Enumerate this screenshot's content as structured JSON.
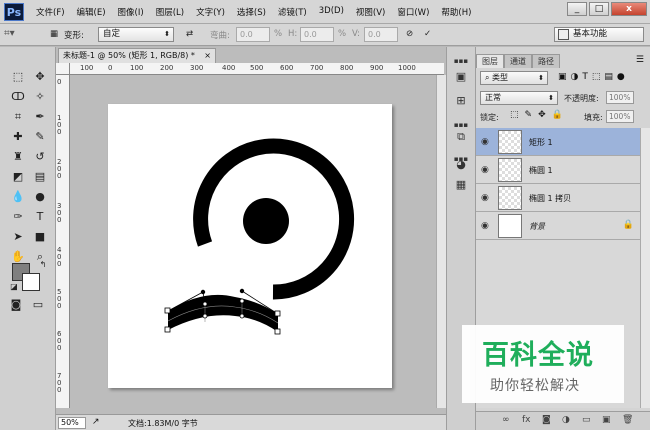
{
  "app": {
    "logo": "Ps"
  },
  "menu": [
    "文件(F)",
    "编辑(E)",
    "图像(I)",
    "图层(L)",
    "文字(Y)",
    "选择(S)",
    "滤镜(T)",
    "3D(D)",
    "视图(V)",
    "窗口(W)",
    "帮助(H)"
  ],
  "window_buttons": {
    "minimize": "_",
    "maximize": "□",
    "close": "x"
  },
  "options": {
    "transform_label": "变形:",
    "transform_value": "自定",
    "bend_label": "弯曲:",
    "bend_value": "0.0",
    "h_label": "H:",
    "h_value": "0.0",
    "percent1": "%",
    "v_label": "V:",
    "v_value": "0.0",
    "percent2": "%",
    "workspace": "基本功能"
  },
  "document": {
    "tab_title": "未标题-1 @ 50% (矩形 1, RGB/8) *",
    "close": "×",
    "ruler_h": [
      "100",
      "0",
      "100",
      "200",
      "300",
      "400",
      "500",
      "600",
      "700",
      "800",
      "900",
      "1000"
    ],
    "ruler_v": [
      "0",
      "1\n0\n0",
      "2\n0\n0",
      "3\n0\n0",
      "4\n0\n0",
      "5\n0\n0",
      "6\n0\n0",
      "7\n0\n0"
    ],
    "zoom": "50%",
    "doc_info": "文档:1.83M/0 字节"
  },
  "layers_panel": {
    "tabs": [
      "图层",
      "通道",
      "路径"
    ],
    "filter_type": "类型",
    "blend_mode": "正常",
    "opacity_label": "不透明度:",
    "opacity_value": "100%",
    "lock_label": "锁定:",
    "fill_label": "填充:",
    "fill_value": "100%",
    "layers": [
      {
        "name": "矩形 1",
        "selected": true
      },
      {
        "name": "椭圆 1",
        "selected": false
      },
      {
        "name": "椭圆 1 拷贝",
        "selected": false
      },
      {
        "name": "背景",
        "selected": false,
        "locked": true
      }
    ],
    "bottom_icons": [
      "link-icon",
      "fx-icon",
      "mask-icon",
      "adjustment-icon",
      "group-icon",
      "new-layer-icon",
      "trash-icon"
    ]
  },
  "watermark": {
    "title": "百科全说",
    "subtitle": "助你轻松解决"
  },
  "colors": {
    "accent_selected": "#9cb3da",
    "watermark_green": "#1fae5b",
    "foreground": "#7f7f7f",
    "background": "#ffffff"
  }
}
